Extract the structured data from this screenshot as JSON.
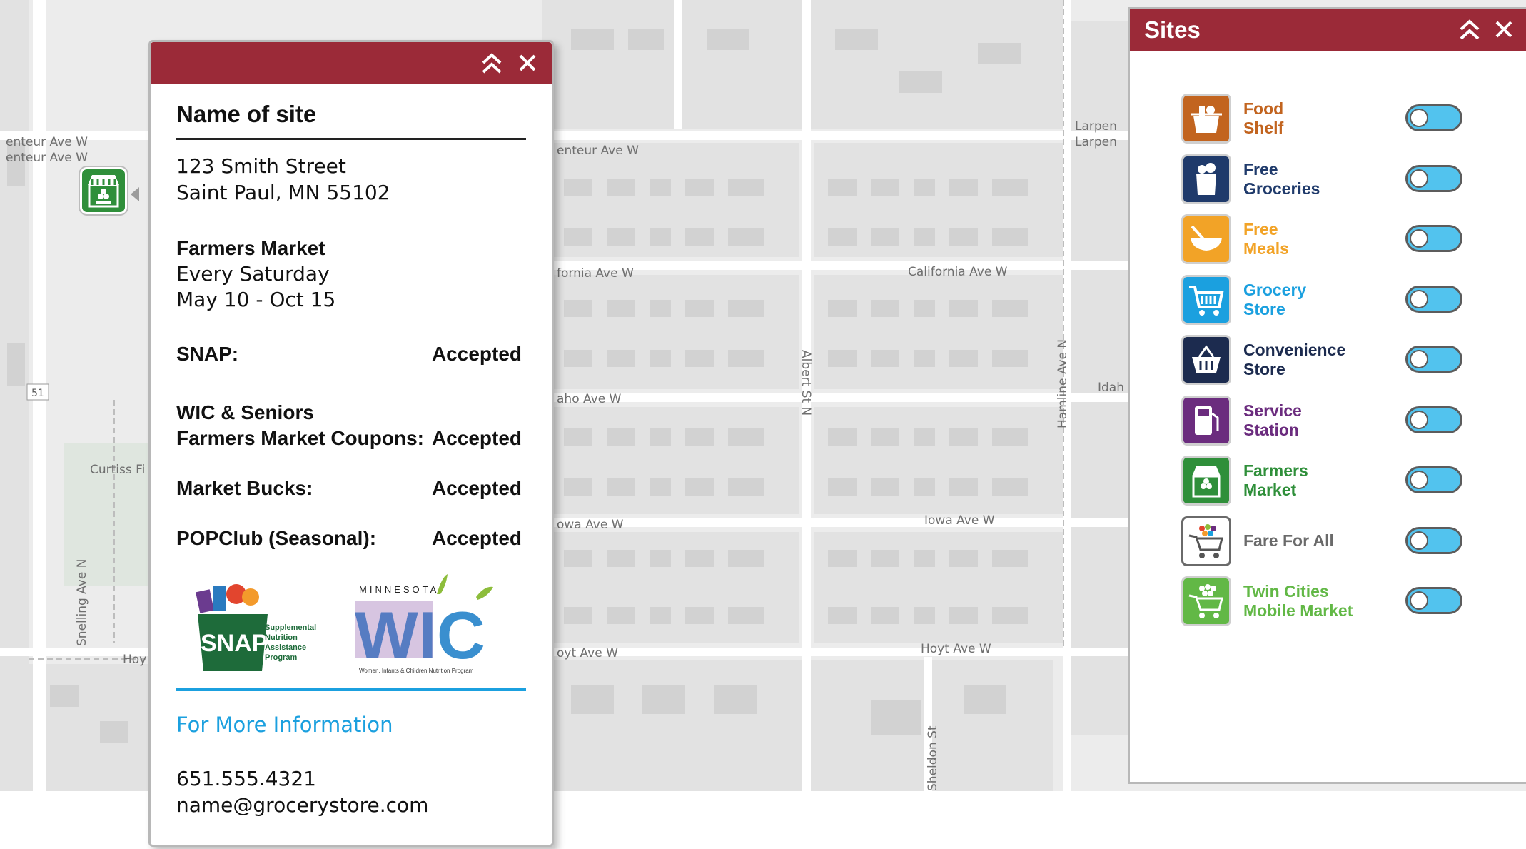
{
  "map": {
    "streets": {
      "larpenteur_left": "enteur Ave W",
      "larpenteur_left2": "enteur Ave W",
      "larpenteur_mid": "enteur Ave W",
      "larpenteur_right": "Larpen",
      "larpenteur_right2": "Larpen",
      "california_left": "fornia Ave W",
      "california_mid": "California Ave W",
      "idaho_left": "aho Ave W",
      "idaho_right": "Idah",
      "iowa_left": "owa Ave W",
      "iowa_mid": "Iowa Ave W",
      "hoyt_left": "Hoy",
      "hoyt_mid": "oyt Ave W",
      "hoyt_right": "Hoyt Ave W",
      "albert": "Albert St N",
      "hamline": "Hamline Ave N",
      "snelling": "Snelling Ave N",
      "sheldon": "Sheldon St",
      "curtiss": "Curtiss Fi",
      "route": "51"
    },
    "marker_icon": "farmers-market-icon"
  },
  "popup": {
    "site_name": "Name of site",
    "address_line1": "123 Smith Street",
    "address_line2": "Saint Paul, MN 55102",
    "market_title": "Farmers Market",
    "market_schedule": "Every Saturday",
    "market_dates": "May 10 - Oct 15",
    "rows": [
      {
        "label": "SNAP:",
        "value": "Accepted"
      },
      {
        "label_line1": "WIC & Seniors",
        "label_line2": "Farmers Market Coupons:",
        "value": "Accepted"
      },
      {
        "label": "Market Bucks:",
        "value": "Accepted"
      },
      {
        "label": "POPClub (Seasonal):",
        "value": "Accepted"
      }
    ],
    "snap_logo": {
      "wordmark": "SNAP",
      "line1": "Supplemental",
      "line2": "Nutrition",
      "line3": "Assistance",
      "line4": "Program"
    },
    "wic_logo": {
      "state": "MINNESOTA",
      "wordmark": "WIC",
      "tagline": "Women, Infants & Children Nutrition Program"
    },
    "more_info": "For More Information",
    "phone": "651.555.4321",
    "email": "name@grocerystore.com",
    "header_color": "#9b2a38",
    "link_color": "#1ba0df"
  },
  "sites_panel": {
    "title": "Sites",
    "items": [
      {
        "line1": "Food",
        "line2": "Shelf",
        "color": "#c2641f",
        "icon": "food-shelf-icon",
        "toggle": "off"
      },
      {
        "line1": "Free",
        "line2": "Groceries",
        "color": "#1f3a6b",
        "icon": "free-groceries-icon",
        "toggle": "off"
      },
      {
        "line1": "Free",
        "line2": "Meals",
        "color": "#f2a327",
        "icon": "free-meals-icon",
        "toggle": "off"
      },
      {
        "line1": "Grocery",
        "line2": "Store",
        "color": "#1ba0df",
        "icon": "grocery-cart-icon",
        "toggle": "off"
      },
      {
        "line1": "Convenience",
        "line2": "Store",
        "color": "#1c2b4f",
        "icon": "basket-icon",
        "toggle": "off"
      },
      {
        "line1": "Service",
        "line2": "Station",
        "color": "#6b2c7e",
        "icon": "fuel-pump-icon",
        "toggle": "off"
      },
      {
        "line1": "Farmers",
        "line2": "Market",
        "color": "#2f8f3a",
        "icon": "farmers-market-icon",
        "toggle": "off"
      },
      {
        "line1": "Fare For All",
        "line2": "",
        "color": "#6a6a6a",
        "icon": "produce-cart-icon",
        "toggle": "off"
      },
      {
        "line1": "Twin Cities",
        "line2": "Mobile Market",
        "color": "#62b846",
        "icon": "mobile-market-icon",
        "toggle": "off"
      }
    ]
  }
}
